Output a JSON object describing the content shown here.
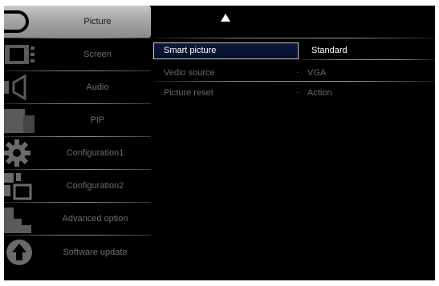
{
  "menu": {
    "items": [
      {
        "label": "Picture",
        "icon": "picture-icon",
        "selected": true
      },
      {
        "label": "Screen",
        "icon": "screen-icon",
        "selected": false
      },
      {
        "label": "Audio",
        "icon": "audio-icon",
        "selected": false
      },
      {
        "label": "PIP",
        "icon": "pip-icon",
        "selected": false
      },
      {
        "label": "Configuration1",
        "icon": "gear-icon",
        "selected": false
      },
      {
        "label": "Configuration2",
        "icon": "configuration2-icon",
        "selected": false
      },
      {
        "label": "Advanced option",
        "icon": "advanced-option-icon",
        "selected": false
      },
      {
        "label": "Software update",
        "icon": "software-update-icon",
        "selected": false
      }
    ]
  },
  "panel": {
    "scroll_up_icon": "up-arrow-icon",
    "rows": [
      {
        "name": "Smart picture",
        "value": "Standard",
        "selected": true,
        "marker": ""
      },
      {
        "name": "Vedio source",
        "value": "VGA",
        "selected": false,
        "marker": "·"
      },
      {
        "name": "Picture reset",
        "value": "Action",
        "selected": false,
        "marker": "·"
      }
    ]
  },
  "colors": {
    "background": "#000000",
    "selected_menu": "#a8a8a8",
    "selected_row": "#0a1838",
    "dim_text": "#6d6d6d"
  }
}
